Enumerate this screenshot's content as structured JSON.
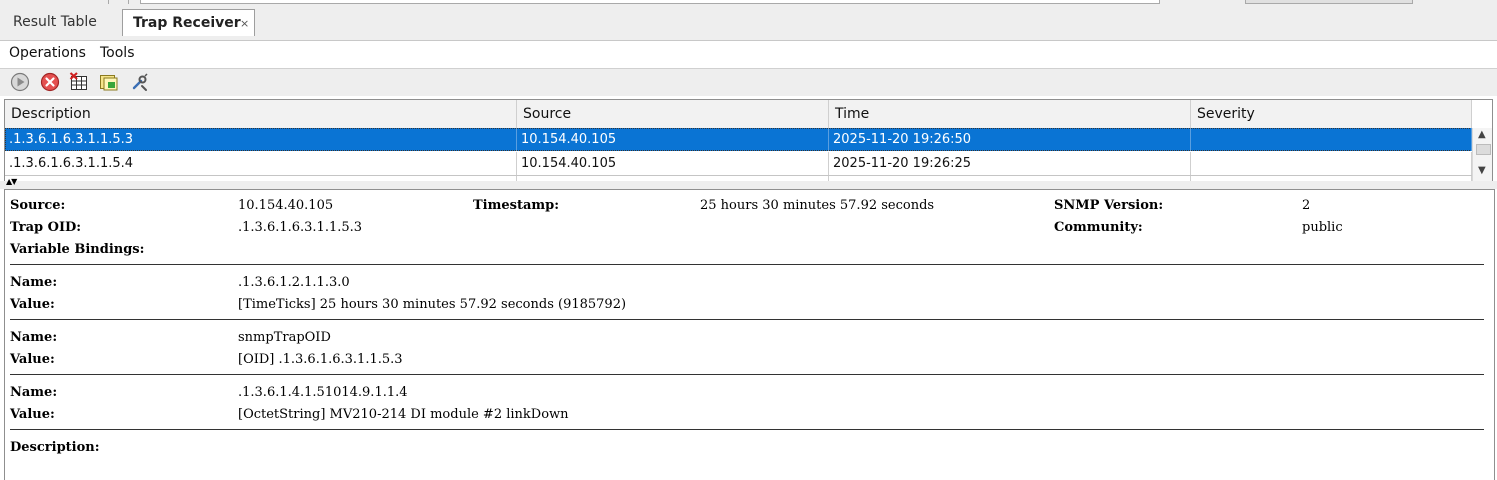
{
  "tabs": {
    "result_table": "Result Table",
    "trap_receiver": "Trap Receiver",
    "close_glyph": "×"
  },
  "menu": {
    "operations": "Operations",
    "tools": "Tools"
  },
  "toolbar": {
    "icons": [
      "play-icon",
      "stop-icon",
      "clear-table-icon",
      "view-details-icon",
      "settings-icon"
    ]
  },
  "table": {
    "columns": [
      "Description",
      "Source",
      "Time",
      "Severity"
    ],
    "rows": [
      {
        "description": ".1.3.6.1.6.3.1.1.5.3",
        "source": "10.154.40.105",
        "time": "2025-11-20 19:26:50",
        "severity": "",
        "selected": true
      },
      {
        "description": ".1.3.6.1.6.3.1.1.5.4",
        "source": "10.154.40.105",
        "time": "2025-11-20 19:26:25",
        "severity": "",
        "selected": false
      }
    ]
  },
  "details": {
    "source_label": "Source:",
    "source_value": "10.154.40.105",
    "timestamp_label": "Timestamp:",
    "timestamp_value": "25 hours 30 minutes 57.92 seconds",
    "snmp_version_label": "SNMP Version:",
    "snmp_version_value": "2",
    "trap_oid_label": "Trap OID:",
    "trap_oid_value": ".1.3.6.1.6.3.1.1.5.3",
    "community_label": "Community:",
    "community_value": "public",
    "variable_bindings_label": "Variable Bindings:",
    "bindings": [
      {
        "name_label": "Name:",
        "name": ".1.3.6.1.2.1.1.3.0",
        "value_label": "Value:",
        "value": "[TimeTicks] 25 hours 30 minutes 57.92 seconds (9185792)"
      },
      {
        "name_label": "Name:",
        "name": "snmpTrapOID",
        "value_label": "Value:",
        "value": "[OID] .1.3.6.1.6.3.1.1.5.3"
      },
      {
        "name_label": "Name:",
        "name": ".1.3.6.1.4.1.51014.9.1.1.4",
        "value_label": "Value:",
        "value": "[OctetString] MV210-214 DI module #2 linkDown"
      }
    ],
    "description_label": "Description:"
  },
  "colors": {
    "selection": "#0a74d4",
    "chrome": "#eeeeee"
  }
}
